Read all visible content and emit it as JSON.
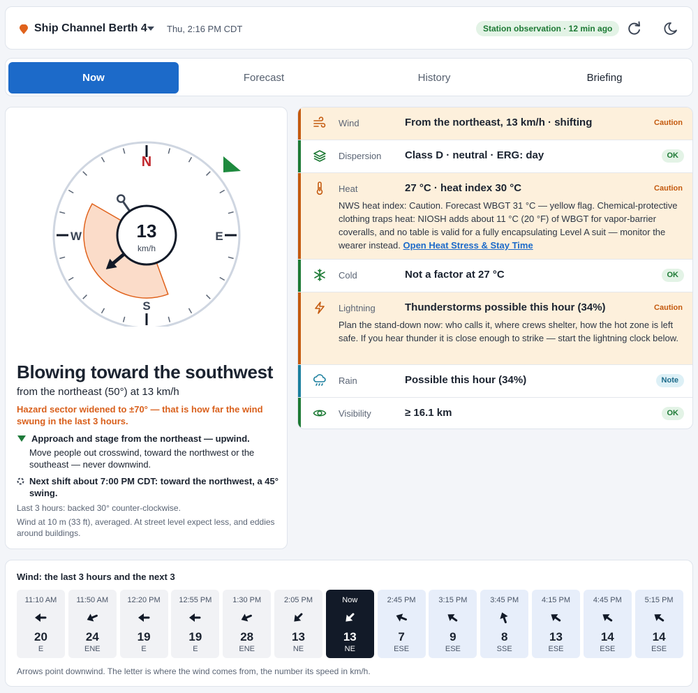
{
  "header": {
    "location": "Ship Channel Berth 4",
    "time": "Thu, 2:16 PM CDT",
    "status": "Station observation · 12 min ago",
    "refresh_icon": "refresh-icon",
    "theme_icon": "moon-icon",
    "pin_color": "#e0621c"
  },
  "tabs": [
    {
      "label": "Now",
      "active": true
    },
    {
      "label": "Forecast",
      "active": false
    },
    {
      "label": "History",
      "active": false
    },
    {
      "label": "Briefing",
      "active": false
    }
  ],
  "compass": {
    "n": "N",
    "e": "E",
    "s": "S",
    "w": "W",
    "speed": "13",
    "unit": "km/h",
    "from_deg": 50,
    "sector_half_width_deg": 70,
    "next_shift_deg": 45
  },
  "summary": {
    "headline": "Blowing toward the southwest",
    "sub": "from the northeast (50°) at 13 km/h",
    "warning": "Hazard sector widened to ±70° — that is how far the wind swung in the last 3 hours.",
    "approach_title": "Approach and stage from the northeast — upwind.",
    "approach_desc": "Move people out crosswind, toward the northwest or the southeast — never downwind.",
    "shift": "Next shift about 7:00 PM CDT: toward the northwest, a 45° swing.",
    "last3": "Last 3 hours: backed 30° counter-clockwise.",
    "note": "Wind at 10 m (33 ft), averaged. At street level expect less, and eddies around buildings."
  },
  "conditions": [
    {
      "label": "Wind",
      "value": "From the northeast, 13 km/h · shifting",
      "status": "Caution",
      "kind": "caution",
      "icon": "wind-icon"
    },
    {
      "label": "Dispersion",
      "value": "Class D · neutral · ERG: day",
      "status": "OK",
      "kind": "ok",
      "icon": "layers-icon"
    },
    {
      "label": "Heat",
      "value": "27 °C · heat index 30 °C",
      "status": "Caution",
      "kind": "caution",
      "icon": "thermometer-icon",
      "desc": "NWS heat index: Caution. Forecast WBGT 31 °C — yellow flag. Chemical-protective clothing traps heat: NIOSH adds about 11 °C (20 °F) of WBGT for vapor-barrier coveralls, and no table is valid for a fully encapsulating Level A suit — monitor the wearer instead.",
      "link": "Open Heat Stress & Stay Time"
    },
    {
      "label": "Cold",
      "value": "Not a factor at 27 °C",
      "status": "OK",
      "kind": "ok",
      "icon": "snowflake-icon"
    },
    {
      "label": "Lightning",
      "value": "Thunderstorms possible this hour (34%)",
      "status": "Caution",
      "kind": "caution",
      "icon": "lightning-icon",
      "desc": "Plan the stand-down now: who calls it, where crews shelter, how the hot zone is left safe. If you hear thunder it is close enough to strike — start the lightning clock below."
    },
    {
      "label": "Rain",
      "value": "Possible this hour (34%)",
      "status": "Note",
      "kind": "note",
      "icon": "rain-cloud-icon"
    },
    {
      "label": "Visibility",
      "value": "≥ 16.1 km",
      "status": "OK",
      "kind": "ok",
      "icon": "eye-icon"
    }
  ],
  "colors": {
    "caution": "#c45a0f",
    "ok": "#1d7a35",
    "note": "#1b7f9e",
    "accent": "#1c6ac9"
  },
  "timeline": {
    "title": "Wind: the last 3 hours and the next 3",
    "footer": "Arrows point downwind. The letter is where the wind comes from, the number its speed in km/h.",
    "hours": [
      {
        "time": "11:10 AM",
        "speed": "20",
        "dir": "E",
        "deg": 90,
        "kind": "past"
      },
      {
        "time": "11:50 AM",
        "speed": "24",
        "dir": "ENE",
        "deg": 67,
        "kind": "past"
      },
      {
        "time": "12:20 PM",
        "speed": "19",
        "dir": "E",
        "deg": 90,
        "kind": "past"
      },
      {
        "time": "12:55 PM",
        "speed": "19",
        "dir": "E",
        "deg": 90,
        "kind": "past"
      },
      {
        "time": "1:30 PM",
        "speed": "28",
        "dir": "ENE",
        "deg": 67,
        "kind": "past"
      },
      {
        "time": "2:05 PM",
        "speed": "13",
        "dir": "NE",
        "deg": 45,
        "kind": "past"
      },
      {
        "time": "Now",
        "speed": "13",
        "dir": "NE",
        "deg": 45,
        "kind": "now"
      },
      {
        "time": "2:45 PM",
        "speed": "7",
        "dir": "ESE",
        "deg": 112,
        "kind": "future"
      },
      {
        "time": "3:15 PM",
        "speed": "9",
        "dir": "ESE",
        "deg": 125,
        "kind": "future"
      },
      {
        "time": "3:45 PM",
        "speed": "8",
        "dir": "SSE",
        "deg": 160,
        "kind": "future"
      },
      {
        "time": "4:15 PM",
        "speed": "13",
        "dir": "ESE",
        "deg": 125,
        "kind": "future"
      },
      {
        "time": "4:45 PM",
        "speed": "14",
        "dir": "ESE",
        "deg": 125,
        "kind": "future"
      },
      {
        "time": "5:15 PM",
        "speed": "14",
        "dir": "ESE",
        "deg": 125,
        "kind": "future"
      }
    ]
  }
}
